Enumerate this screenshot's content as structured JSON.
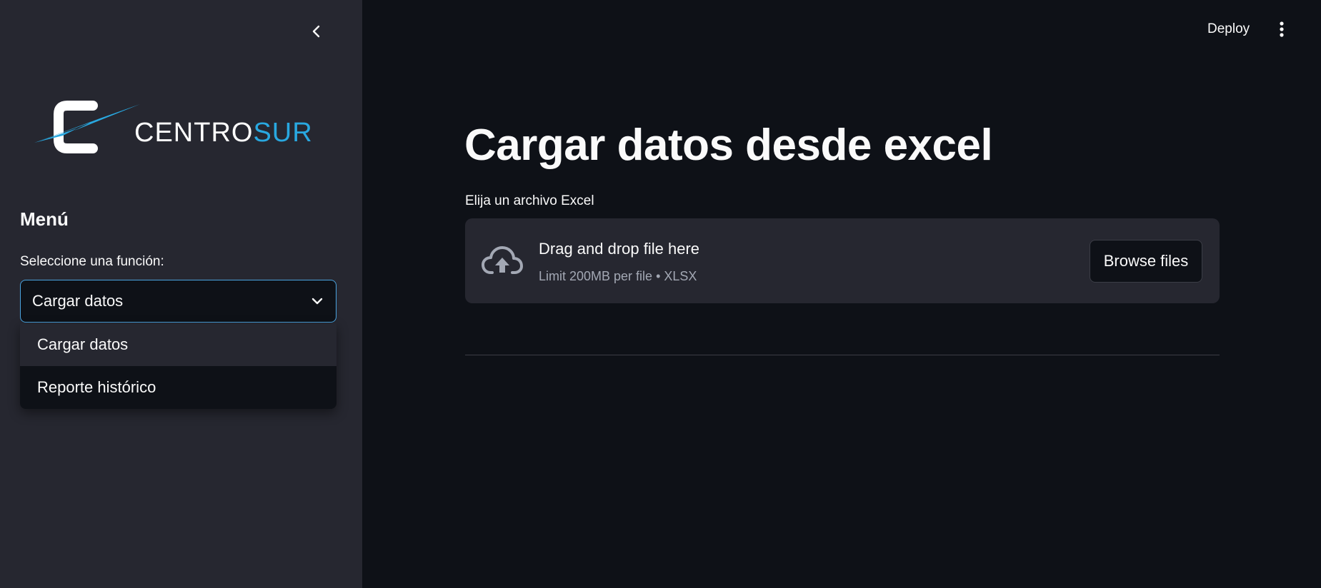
{
  "sidebar": {
    "logo_text_1": "CENTRO",
    "logo_text_2": "SUR",
    "menu_title": "Menú",
    "select_label": "Seleccione una función:",
    "select_value": "Cargar datos",
    "options": [
      {
        "label": "Cargar datos"
      },
      {
        "label": "Reporte histórico"
      }
    ]
  },
  "header": {
    "deploy_label": "Deploy"
  },
  "main": {
    "title": "Cargar datos desde excel",
    "uploader_label": "Elija un archivo Excel",
    "drop_text": "Drag and drop file here",
    "limit_text": "Limit 200MB per file • XLSX",
    "browse_label": "Browse files"
  },
  "colors": {
    "sidebar_bg": "#262730",
    "main_bg": "#0e1117",
    "accent_blue": "#29a8e0",
    "focus_border": "#4aa3df"
  },
  "icons": {
    "collapse": "chevron-left-icon",
    "select": "chevron-down-icon",
    "menu": "vertical-dots-icon",
    "upload": "cloud-upload-icon"
  }
}
